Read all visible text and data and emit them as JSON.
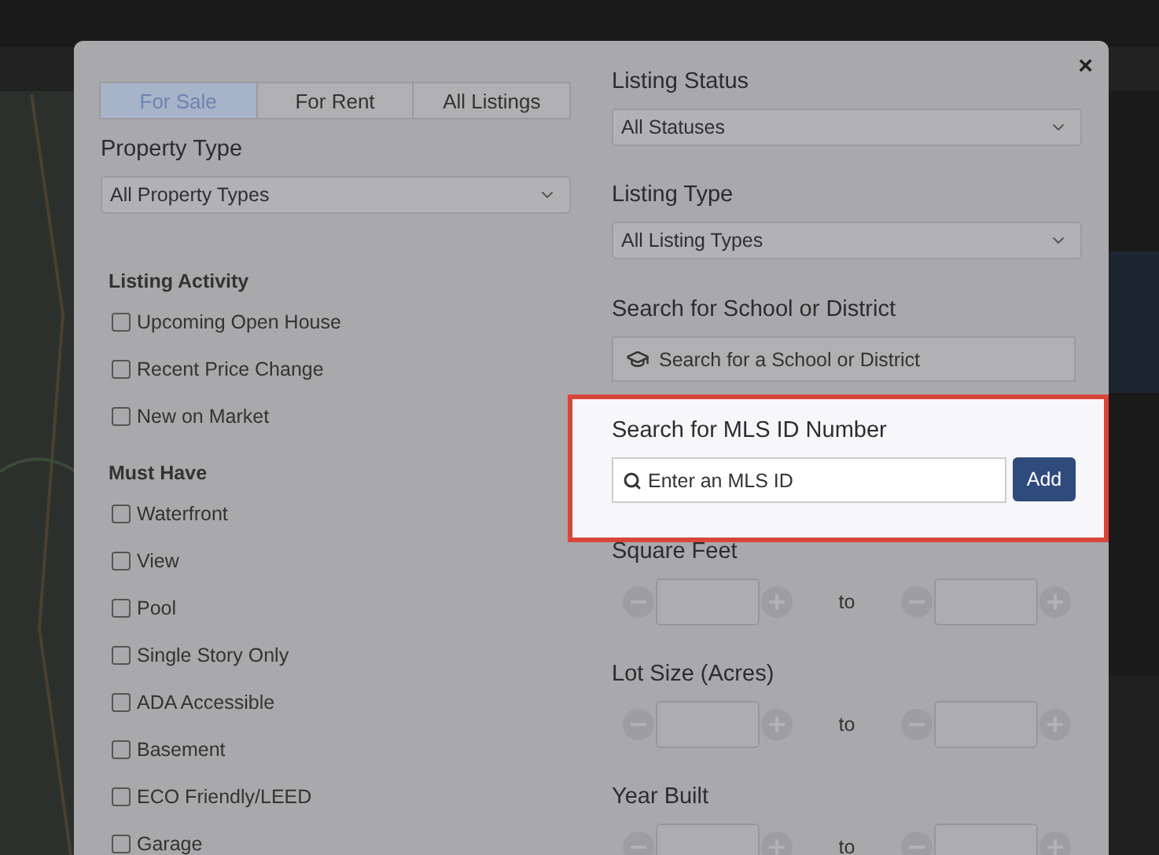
{
  "close": "×",
  "tabs": [
    {
      "label": "For Sale",
      "selected": true
    },
    {
      "label": "For Rent",
      "selected": false
    },
    {
      "label": "All Listings",
      "selected": false
    }
  ],
  "property_type": {
    "label": "Property Type",
    "value": "All Property Types"
  },
  "checkbox_groups": [
    {
      "title": "Listing Activity",
      "items": [
        {
          "label": "Upcoming Open House",
          "checked": false
        },
        {
          "label": "Recent Price Change",
          "checked": false
        },
        {
          "label": "New on Market",
          "checked": false
        }
      ]
    },
    {
      "title": "Must Have",
      "items": [
        {
          "label": "Waterfront",
          "checked": false
        },
        {
          "label": "View",
          "checked": false
        },
        {
          "label": "Pool",
          "checked": false
        },
        {
          "label": "Single Story Only",
          "checked": false
        },
        {
          "label": "ADA Accessible",
          "checked": false
        },
        {
          "label": "Basement",
          "checked": false
        },
        {
          "label": "ECO Friendly/LEED",
          "checked": false
        },
        {
          "label": "Garage",
          "checked": false
        }
      ]
    }
  ],
  "listing_status": {
    "label": "Listing Status",
    "value": "All Statuses"
  },
  "listing_type": {
    "label": "Listing Type",
    "value": "All Listing Types"
  },
  "school_search": {
    "label": "Search for School or District",
    "placeholder": "Search for a School or District"
  },
  "mls_search": {
    "label": "Search for MLS ID Number",
    "placeholder": "Enter an MLS ID",
    "button": "Add",
    "highlighted": true
  },
  "ranges": [
    {
      "label": "Square Feet",
      "separator": "to"
    },
    {
      "label": "Lot Size (Acres)",
      "separator": "to"
    },
    {
      "label": "Year Built",
      "separator": "to"
    }
  ]
}
